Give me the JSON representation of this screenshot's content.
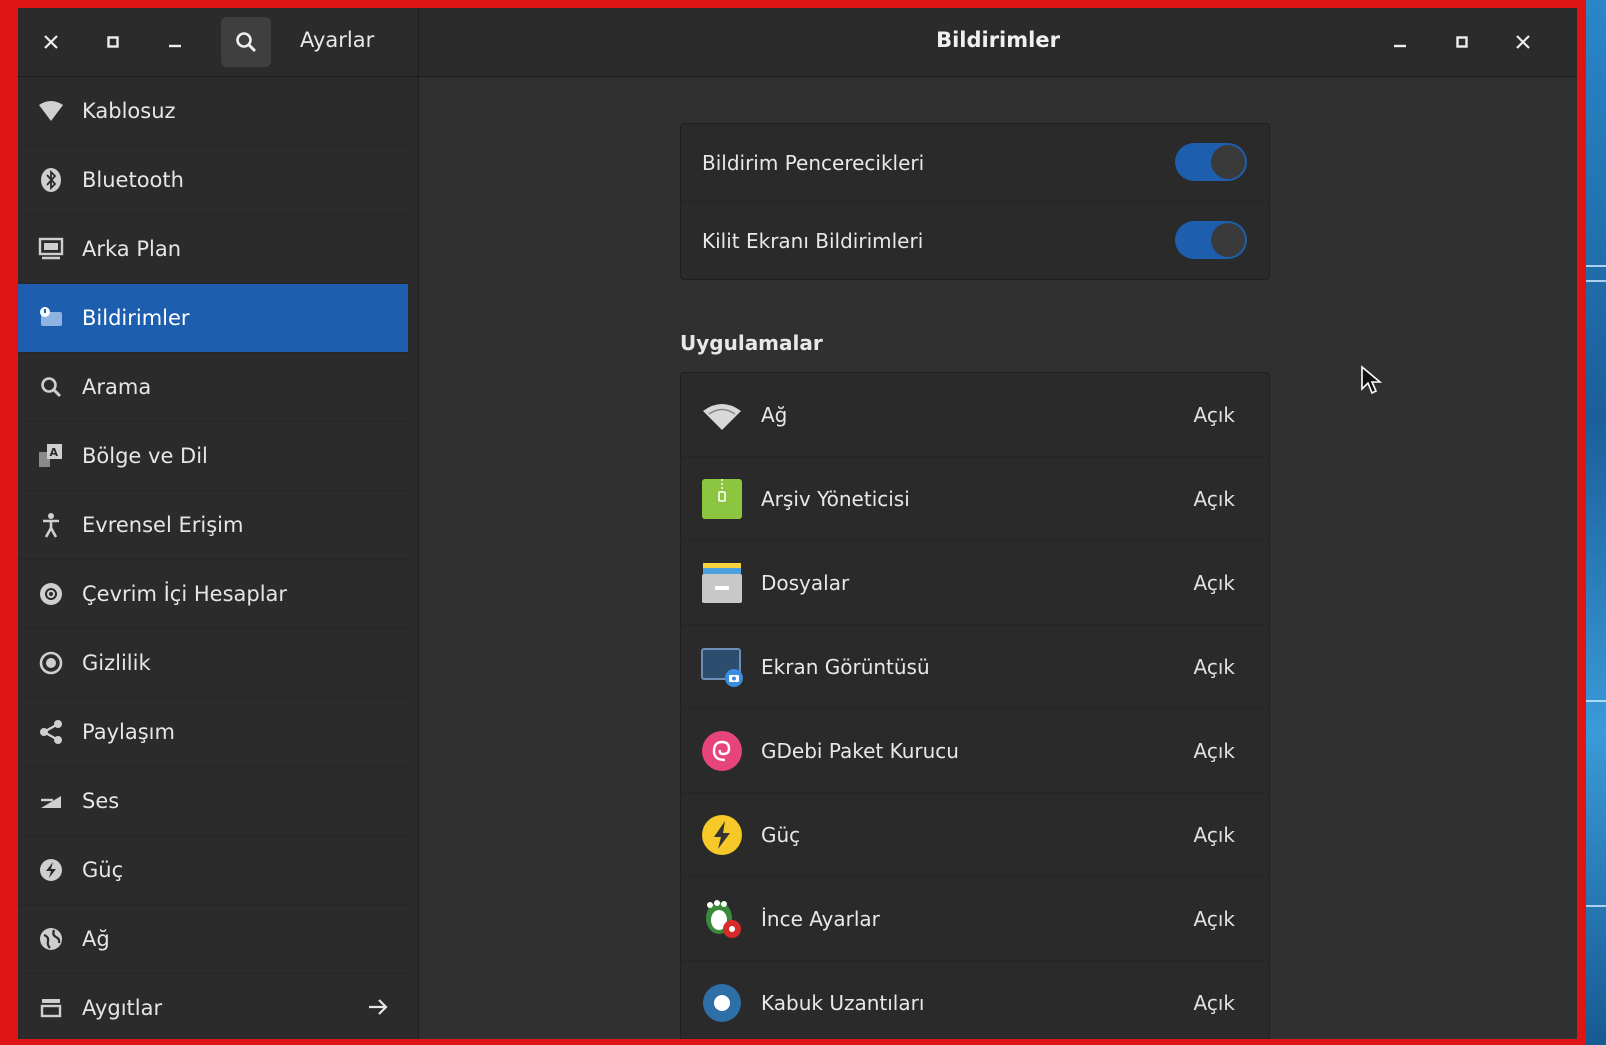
{
  "header": {
    "left_title": "Ayarlar",
    "center_title": "Bildirimler"
  },
  "sidebar": {
    "items": [
      {
        "label": "Kablosuz",
        "icon": "wifi-icon"
      },
      {
        "label": "Bluetooth",
        "icon": "bluetooth-icon"
      },
      {
        "label": "Arka Plan",
        "icon": "display-icon"
      },
      {
        "label": "Bildirimler",
        "icon": "notification-icon",
        "selected": true
      },
      {
        "label": "Arama",
        "icon": "search-icon"
      },
      {
        "label": "Bölge ve Dil",
        "icon": "region-language-icon"
      },
      {
        "label": "Evrensel Erişim",
        "icon": "accessibility-icon"
      },
      {
        "label": "Çevrim İçi Hesaplar",
        "icon": "online-accounts-icon"
      },
      {
        "label": "Gizlilik",
        "icon": "privacy-icon"
      },
      {
        "label": "Paylaşım",
        "icon": "share-icon"
      },
      {
        "label": "Ses",
        "icon": "sound-icon"
      },
      {
        "label": "Güç",
        "icon": "power-icon"
      },
      {
        "label": "Ağ",
        "icon": "network-icon"
      },
      {
        "label": "Aygıtlar",
        "icon": "devices-icon"
      }
    ]
  },
  "settings": {
    "popups_label": "Bildirim Pencerecikleri",
    "popups_on": true,
    "lockscreen_label": "Kilit Ekranı Bildirimleri",
    "lockscreen_on": true
  },
  "apps_section": {
    "title": "Uygulamalar",
    "apps": [
      {
        "name": "Ağ",
        "status": "Açık",
        "icon": "network-wifi-icon"
      },
      {
        "name": "Arşiv Yöneticisi",
        "status": "Açık",
        "icon": "archive-manager-icon"
      },
      {
        "name": "Dosyalar",
        "status": "Açık",
        "icon": "files-icon"
      },
      {
        "name": "Ekran Görüntüsü",
        "status": "Açık",
        "icon": "screenshot-icon"
      },
      {
        "name": "GDebi Paket Kurucu",
        "status": "Açık",
        "icon": "gdebi-icon"
      },
      {
        "name": "Güç",
        "status": "Açık",
        "icon": "power-app-icon"
      },
      {
        "name": "İnce Ayarlar",
        "status": "Açık",
        "icon": "tweaks-icon"
      },
      {
        "name": "Kabuk Uzantıları",
        "status": "Açık",
        "icon": "shell-extensions-icon"
      }
    ]
  },
  "colors": {
    "accent": "#1d5fae",
    "frame": "#e01414"
  }
}
